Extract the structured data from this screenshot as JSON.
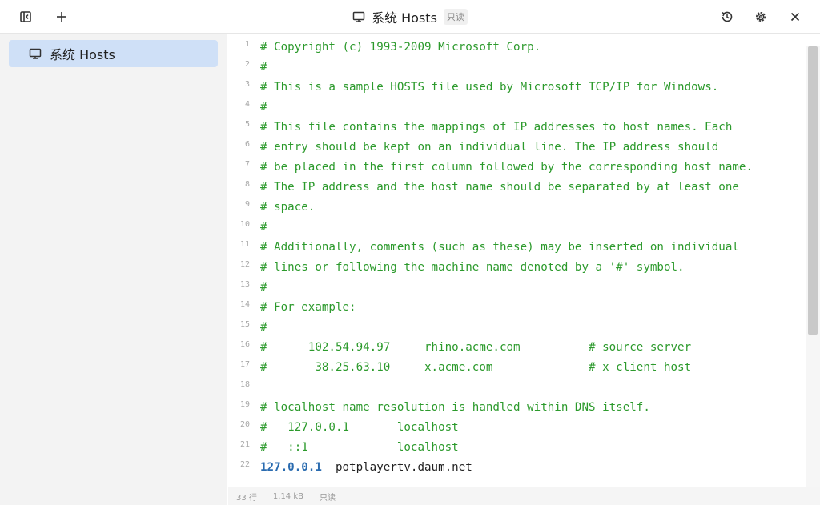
{
  "window": {
    "title": "系统 Hosts",
    "readonly_badge": "只读",
    "icons": {
      "left": [
        "sidebar-toggle-icon",
        "plus-icon"
      ],
      "right": [
        "history-icon",
        "gear-icon",
        "close-icon"
      ]
    }
  },
  "sidebar": {
    "items": [
      {
        "label": "系统 Hosts",
        "icon": "monitor-icon",
        "selected": true
      }
    ]
  },
  "editor": {
    "lines": [
      {
        "num": "1",
        "text": "# Copyright (c) 1993-2009 Microsoft Corp."
      },
      {
        "num": "2",
        "text": "#"
      },
      {
        "num": "3",
        "text": "# This is a sample HOSTS file used by Microsoft TCP/IP for Windows."
      },
      {
        "num": "4",
        "text": "#"
      },
      {
        "num": "5",
        "text": "# This file contains the mappings of IP addresses to host names. Each"
      },
      {
        "num": "6",
        "text": "# entry should be kept on an individual line. The IP address should"
      },
      {
        "num": "7",
        "text": "# be placed in the first column followed by the corresponding host name."
      },
      {
        "num": "8",
        "text": "# The IP address and the host name should be separated by at least one"
      },
      {
        "num": "9",
        "text": "# space."
      },
      {
        "num": "10",
        "text": "#"
      },
      {
        "num": "11",
        "text": "# Additionally, comments (such as these) may be inserted on individual"
      },
      {
        "num": "12",
        "text": "# lines or following the machine name denoted by a '#' symbol."
      },
      {
        "num": "13",
        "text": "#"
      },
      {
        "num": "14",
        "text": "# For example:"
      },
      {
        "num": "15",
        "text": "#"
      },
      {
        "num": "16",
        "text": "#      102.54.94.97     rhino.acme.com          # source server"
      },
      {
        "num": "17",
        "text": "#       38.25.63.10     x.acme.com              # x client host"
      },
      {
        "num": "18",
        "text": ""
      },
      {
        "num": "19",
        "text": "# localhost name resolution is handled within DNS itself."
      },
      {
        "num": "20",
        "text": "#   127.0.0.1       localhost"
      },
      {
        "num": "21",
        "text": "#   ::1             localhost"
      },
      {
        "num": "22",
        "ip": "127.0.0.1",
        "host": "potplayertv.daum.net"
      }
    ]
  },
  "status": {
    "lines": "33 行",
    "size": "1.14 kB",
    "mode": "只读"
  },
  "colors": {
    "comment": "#2c9a2c",
    "ip": "#2b6cb0",
    "selected_bg": "#cfe0f7",
    "sidebar_bg": "#f3f3f3"
  }
}
